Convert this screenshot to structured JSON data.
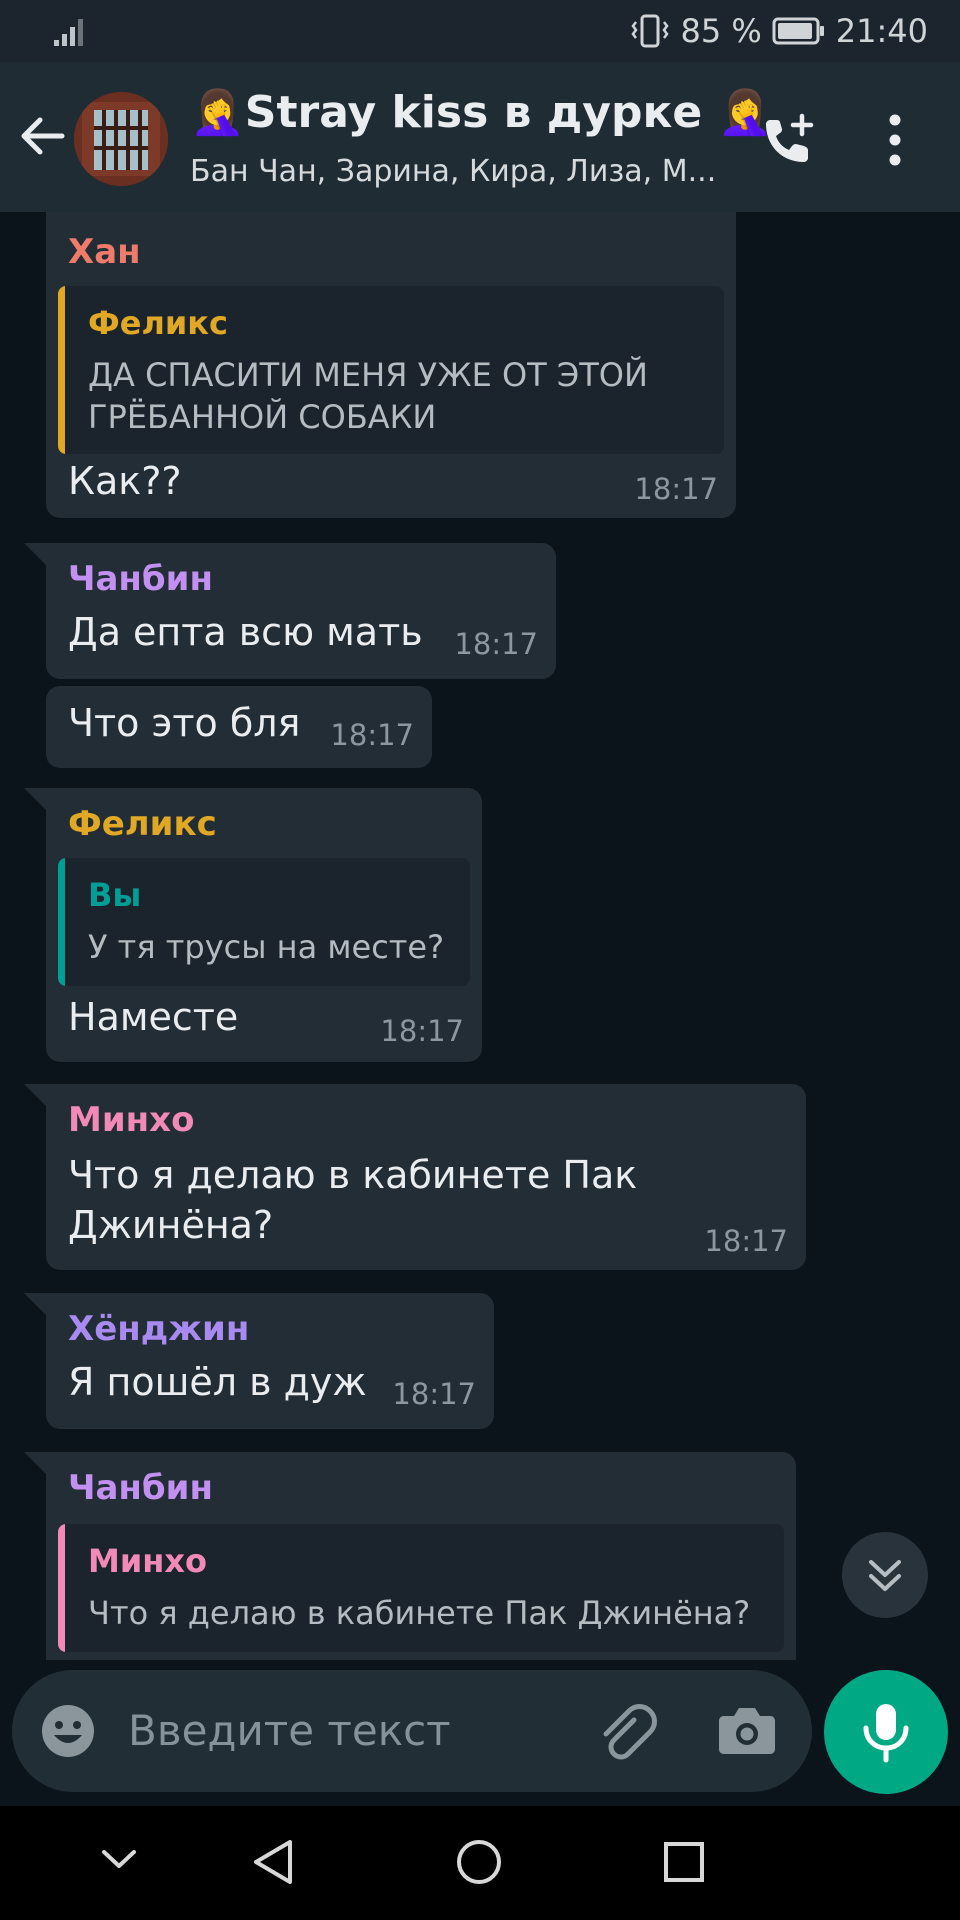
{
  "status_bar": {
    "battery": "85 %",
    "time": "21:40"
  },
  "header": {
    "title": "🤦‍♀️Stray kiss в дурке 🤦‍♀️",
    "subtitle": "Бан Чан, Зарина, Кира, Лиза, М..."
  },
  "colors": {
    "accent": "#00a984",
    "bubble": "#232d36",
    "background": "#0c141b"
  },
  "messages": [
    {
      "sender": "Хан",
      "sender_color": "#ef7b6a",
      "quote_name": "Феликс",
      "quote_color": "#e0a825",
      "quote_line1": "ДА СПАСИТИ МЕНЯ УЖЕ ОТ ЭТОЙ",
      "quote_line2": "ГРЁБАННОЙ СОБАКИ",
      "text": "Как??",
      "time": "18:17"
    },
    {
      "sender": "Чанбин",
      "sender_color": "#c290f0",
      "text": "Да епта всю мать",
      "time": "18:17"
    },
    {
      "text": "Что это бля",
      "time": "18:17"
    },
    {
      "sender": "Феликс",
      "sender_color": "#e0a825",
      "quote_name": "Вы",
      "quote_color": "#009e94",
      "quote_text": "У тя трусы на месте?",
      "text": "Наместе",
      "time": "18:17"
    },
    {
      "sender": "Минхо",
      "sender_color": "#f28ab8",
      "line1": "Что я делаю в кабинете Пак",
      "line2": "Джинёна?",
      "time": "18:17"
    },
    {
      "sender": "Хёнджин",
      "sender_color": "#a98af0",
      "text": "Я пошёл в дуж",
      "time": "18:17"
    },
    {
      "sender": "Чанбин",
      "sender_color": "#c290f0",
      "quote_name": "Минхо",
      "quote_color": "#f28ab8",
      "quote_text": "Что я делаю в кабинете Пак Джинёна?"
    }
  ],
  "input": {
    "placeholder": "Введите текст"
  },
  "icons": [
    "back-arrow-icon",
    "add-call-icon",
    "more-vert-icon",
    "double-chevron-down-icon",
    "emoji-icon",
    "attach-icon",
    "camera-icon",
    "mic-icon",
    "nav-down-icon",
    "nav-back-icon",
    "nav-home-icon",
    "nav-recents-icon"
  ]
}
